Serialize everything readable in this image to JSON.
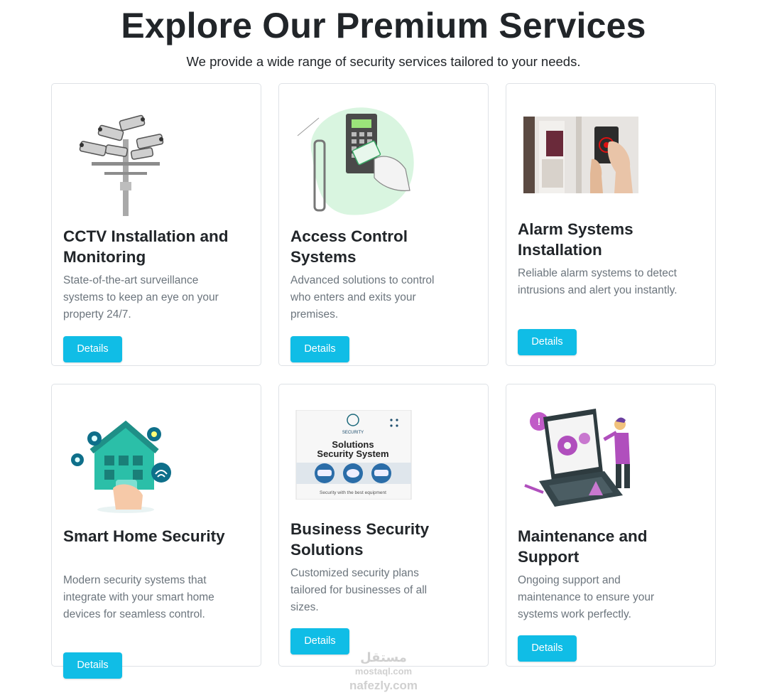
{
  "header": {
    "title": "Explore Our Premium Services",
    "subtitle": "We provide a wide range of security services tailored to your needs."
  },
  "cards": [
    {
      "title": "CCTV Installation and Monitoring",
      "description": "State-of-the-art surveillance systems to keep an eye on your property 24/7.",
      "button": "Details",
      "image_icon": "cctv-cameras-image"
    },
    {
      "title": "Access Control Systems",
      "description": "Advanced solutions to control who enters and exits your premises.",
      "button": "Details",
      "image_icon": "keypad-access-image"
    },
    {
      "title": "Alarm Systems Installation",
      "description": "Reliable alarm systems to detect intrusions and alert you instantly.",
      "button": "Details",
      "image_icon": "alarm-panel-photo"
    },
    {
      "title": "Smart Home Security",
      "description": "Modern security systems that integrate with your smart home devices for seamless control.",
      "button": "Details",
      "image_icon": "smart-home-image"
    },
    {
      "title": "Business Security Solutions",
      "description": "Customized security plans tailored for businesses of all sizes.",
      "button": "Details",
      "image_icon": "business-security-banner",
      "image_text": {
        "badge": "SECURITY",
        "line1": "Solutions",
        "line2": "Security System",
        "caption": "Security with the best equipment"
      }
    },
    {
      "title": "Maintenance and Support",
      "description": "Ongoing support and maintenance to ensure your systems work perfectly.",
      "button": "Details",
      "image_icon": "maintenance-laptop-image"
    }
  ],
  "watermark": {
    "line1": "مستقل",
    "line2": "mostaql.com",
    "line3": "nafezly.com"
  },
  "colors": {
    "accent": "#10bde6",
    "text": "#212529",
    "muted": "#6c757d",
    "border": "#dee2e6"
  }
}
